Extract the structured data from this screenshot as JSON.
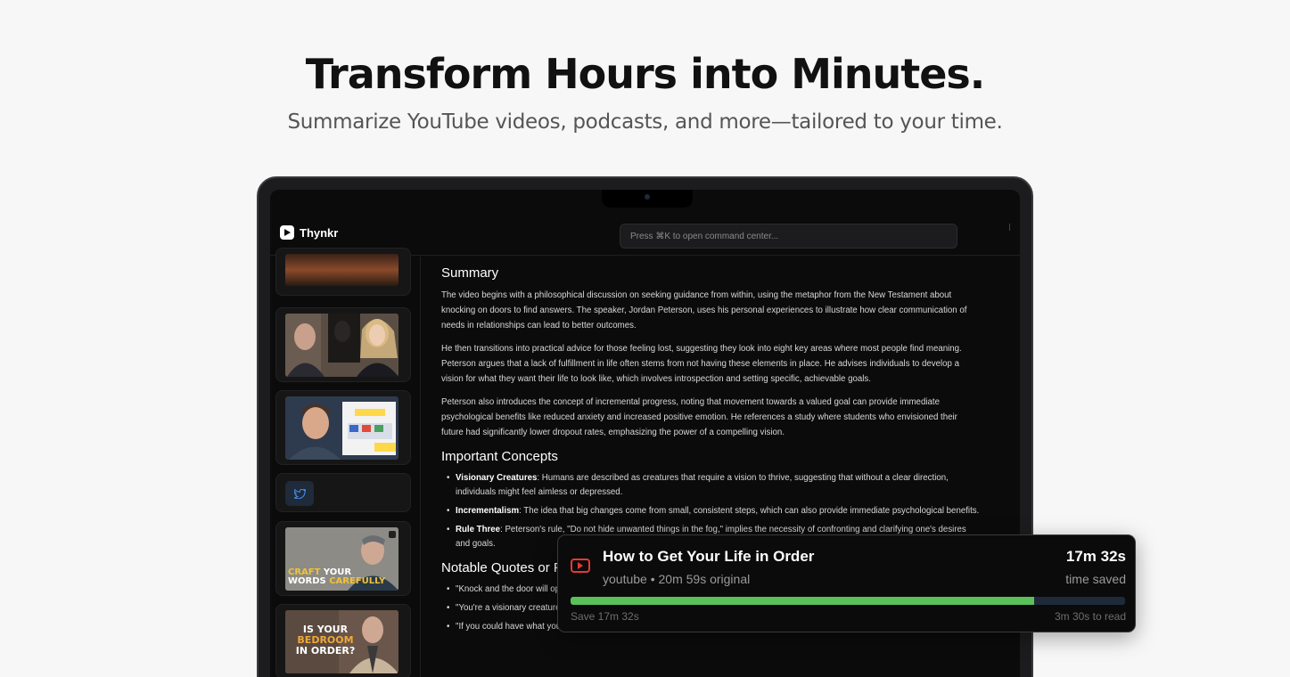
{
  "hero": {
    "title": "Transform Hours into Minutes.",
    "subtitle": "Summarize YouTube videos, podcasts, and more—tailored to your time."
  },
  "app": {
    "brand": "Thynkr",
    "command_placeholder": "Press ⌘K to open command center..."
  },
  "sidebar": {
    "thumb_texts": {
      "craft_line1_a": "CRAFT",
      "craft_line1_b": "YOUR",
      "craft_line2_a": "WORDS",
      "craft_line2_b": "CAREFULLY",
      "bedroom_line1": "IS YOUR",
      "bedroom_line2": "BEDROOM",
      "bedroom_line3": "IN ORDER?"
    }
  },
  "summary": {
    "heading": "Summary",
    "paragraphs": [
      "The video begins with a philosophical discussion on seeking guidance from within, using the metaphor from the New Testament about knocking on doors to find answers. The speaker, Jordan Peterson, uses his personal experiences to illustrate how clear communication of needs in relationships can lead to better outcomes.",
      "He then transitions into practical advice for those feeling lost, suggesting they look into eight key areas where most people find meaning. Peterson argues that a lack of fulfillment in life often stems from not having these elements in place. He advises individuals to develop a vision for what they want their life to look like, which involves introspection and setting specific, achievable goals.",
      "Peterson also introduces the concept of incremental progress, noting that movement towards a valued goal can provide immediate psychological benefits like reduced anxiety and increased positive emotion. He references a study where students who envisioned their future had significantly lower dropout rates, emphasizing the power of a compelling vision."
    ]
  },
  "concepts": {
    "heading": "Important Concepts",
    "items": [
      {
        "term": "Visionary Creatures",
        "text": ": Humans are described as creatures that require a vision to thrive, suggesting that without a clear direction, individuals might feel aimless or depressed."
      },
      {
        "term": "Incrementalism",
        "text": ": The idea that big changes come from small, consistent steps, which can also provide immediate psychological benefits."
      },
      {
        "term": "Rule Three",
        "text": ": Peterson's rule, \"Do not hide unwanted things in the fog,\" implies the necessity of confronting and clarifying one's desires and goals."
      }
    ]
  },
  "quotes": {
    "heading": "Notable Quotes or Phrases",
    "items": [
      "\"Knock and the door will open.\" - Emphasizing the importance of actively seeking answers and clarity through personal effort.",
      "\"You're a visionary creature. You need a compelling vision.\" - Highlighting the human need for purpose and direction.",
      "\"If you could have what you wanted and needed, what would that look like?\" - A prompt for self-reflection on personal desires and needs."
    ]
  },
  "toast": {
    "title": "How to Get Your Life in Order",
    "meta": "youtube • 20m 59s original",
    "saved_value": "17m 32s",
    "saved_label": "time saved",
    "save_label": "Save 17m 32s",
    "read_label": "3m 30s to read",
    "progress_percent": 83.6,
    "progress_color": "#5ac05a"
  }
}
